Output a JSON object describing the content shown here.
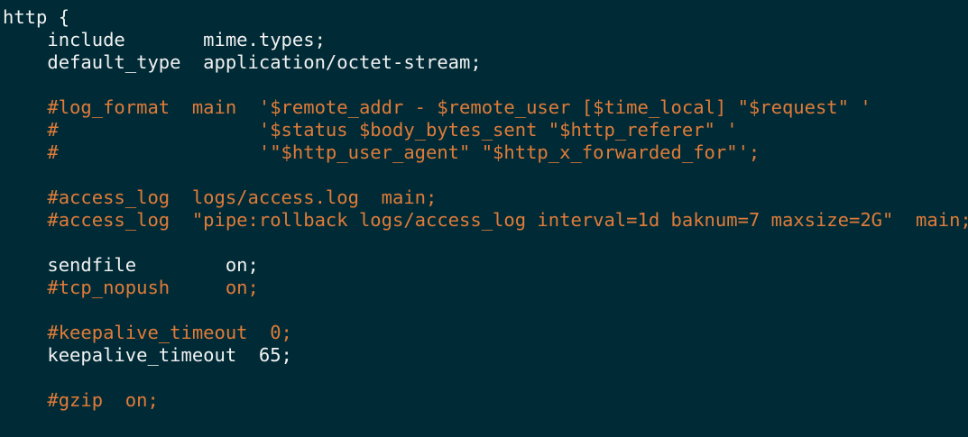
{
  "terminal": {
    "lines": [
      {
        "text": "http {",
        "type": "normal"
      },
      {
        "text": "    include       mime.types;",
        "type": "normal"
      },
      {
        "text": "    default_type  application/octet-stream;",
        "type": "normal"
      },
      {
        "text": "",
        "type": "normal"
      },
      {
        "text": "    #log_format  main  '$remote_addr - $remote_user [$time_local] \"$request\" '",
        "type": "comment"
      },
      {
        "text": "    #                  '$status $body_bytes_sent \"$http_referer\" '",
        "type": "comment"
      },
      {
        "text": "    #                  '\"$http_user_agent\" \"$http_x_forwarded_for\"';",
        "type": "comment"
      },
      {
        "text": "",
        "type": "normal"
      },
      {
        "text": "    #access_log  logs/access.log  main;",
        "type": "comment"
      },
      {
        "text": "    #access_log  \"pipe:rollback logs/access_log interval=1d baknum=7 maxsize=2G\"  main;",
        "type": "comment"
      },
      {
        "text": "",
        "type": "normal"
      },
      {
        "text": "    sendfile        on;",
        "type": "normal"
      },
      {
        "text": "    #tcp_nopush     on;",
        "type": "comment"
      },
      {
        "text": "",
        "type": "normal"
      },
      {
        "text": "    #keepalive_timeout  0;",
        "type": "comment"
      },
      {
        "text": "    keepalive_timeout  65;",
        "type": "normal"
      },
      {
        "text": "",
        "type": "normal"
      },
      {
        "text": "    #gzip  on;",
        "type": "comment"
      }
    ]
  },
  "colors": {
    "background": "#002b36",
    "normal_text": "#f2f2f2",
    "comment_text": "#e07b39"
  }
}
